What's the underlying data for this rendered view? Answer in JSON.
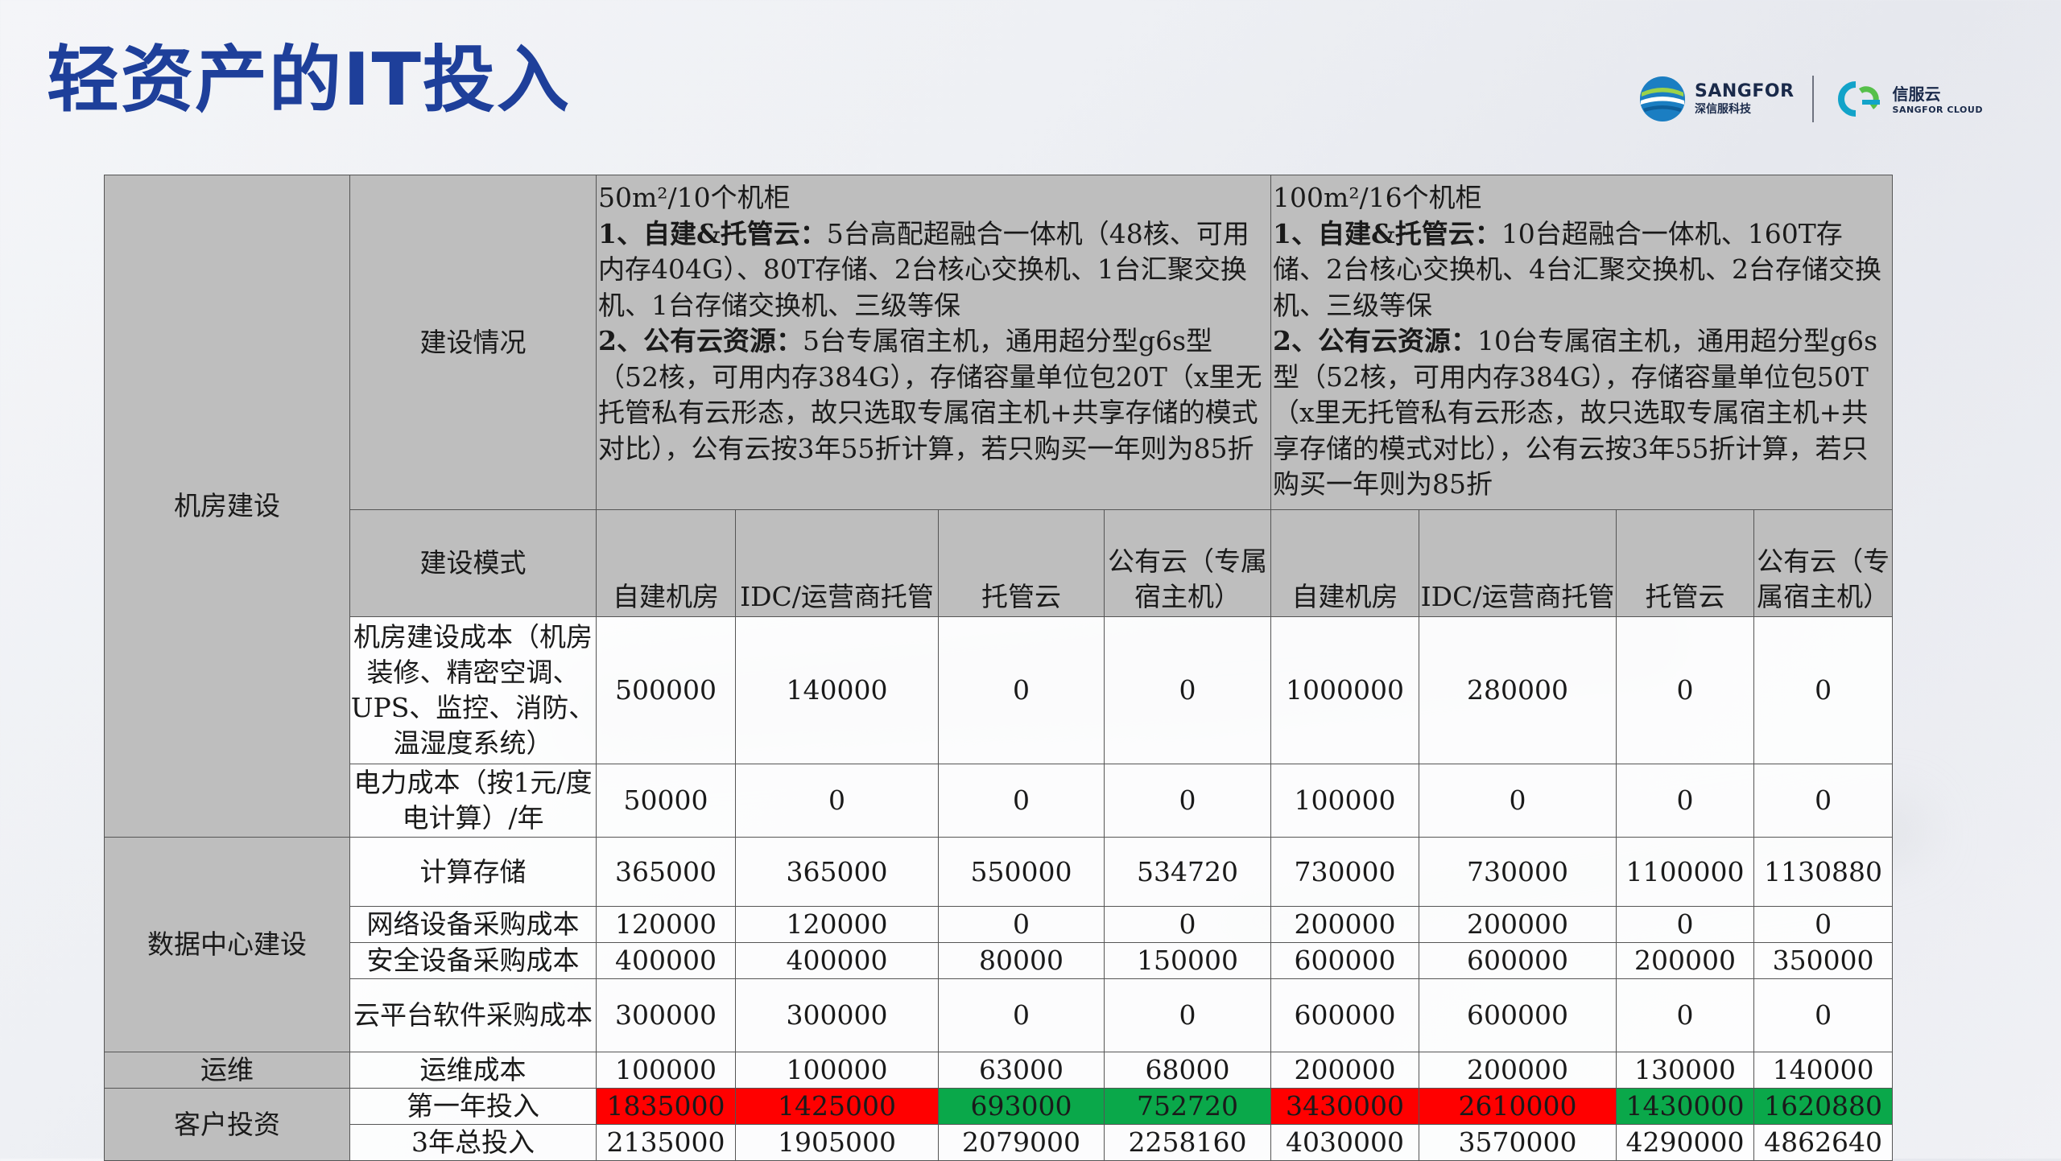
{
  "title": "轻资产的IT投入",
  "logo": {
    "en": "SANGFOR",
    "cn": "深信服科技",
    "cloud_cn": "信服云",
    "cloud_en": "SANGFOR CLOUD"
  },
  "table": {
    "groups": {
      "room": "机房建设",
      "dc": "数据中心建设",
      "ops": "运维",
      "customer": "客户投资"
    },
    "labels": {
      "situation": "建设情况",
      "mode": "建设模式",
      "room_cost": "机房建设成本（机房装修、精密空调、UPS、监控、消防、温湿度系统）",
      "power_cost": "电力成本（按1元/度电计算）/年",
      "compute": "计算存储",
      "network": "网络设备采购成本",
      "security": "安全设备采购成本",
      "cloud_sw": "云平台软件采购成本",
      "ops_cost": "运维成本",
      "first_year": "第一年投入",
      "three_year": "3年总投入"
    },
    "desc_a": {
      "heading": "50m²/10个机柜",
      "p1_bold": "1、自建&托管云：",
      "p1": "5台高配超融合一体机（48核、可用内存404G）、80T存储、2台核心交换机、1台汇聚交换机、1台存储交换机、三级等保",
      "p2_bold": "2、公有云资源：",
      "p2": "5台专属宿主机，通用超分型g6s型（52核，可用内存384G），存储容量单位包20T（x里无托管私有云形态，故只选取专属宿主机+共享存储的模式对比），公有云按3年55折计算，若只购买一年则为85折"
    },
    "desc_b": {
      "heading": "100m²/16个机柜",
      "p1_bold": "1、自建&托管云：",
      "p1": "10台超融合一体机、160T存储、2台核心交换机、4台汇聚交换机、2台存储交换机、三级等保",
      "p2_bold": "2、公有云资源：",
      "p2": "10台专属宿主机，通用超分型g6s型（52核，可用内存384G），存储容量单位包50T（x里无托管私有云形态，故只选取专属宿主机+共享存储的模式对比），公有云按3年55折计算，若只购买一年则为85折"
    },
    "modes": [
      "自建机房",
      "IDC/运营商托管",
      "托管云",
      "公有云（专属宿主机）",
      "自建机房",
      "IDC/运营商托管",
      "托管云",
      "公有云（专属宿主机）"
    ],
    "rows": {
      "room_cost": [
        "500000",
        "140000",
        "0",
        "0",
        "1000000",
        "280000",
        "0",
        "0"
      ],
      "power_cost": [
        "50000",
        "0",
        "0",
        "0",
        "100000",
        "0",
        "0",
        "0"
      ],
      "compute": [
        "365000",
        "365000",
        "550000",
        "534720",
        "730000",
        "730000",
        "1100000",
        "1130880"
      ],
      "network": [
        "120000",
        "120000",
        "0",
        "0",
        "200000",
        "200000",
        "0",
        "0"
      ],
      "security": [
        "400000",
        "400000",
        "80000",
        "150000",
        "600000",
        "600000",
        "200000",
        "350000"
      ],
      "cloud_sw": [
        "300000",
        "300000",
        "0",
        "0",
        "600000",
        "600000",
        "0",
        "0"
      ],
      "ops_cost": [
        "100000",
        "100000",
        "63000",
        "68000",
        "200000",
        "200000",
        "130000",
        "140000"
      ],
      "first_year": [
        "1835000",
        "1425000",
        "693000",
        "752720",
        "3430000",
        "2610000",
        "1430000",
        "1620880"
      ],
      "three_year": [
        "2135000",
        "1905000",
        "2079000",
        "2258160",
        "4030000",
        "3570000",
        "4290000",
        "4862640"
      ]
    },
    "first_year_colors": [
      "#ff0000",
      "#ff0000",
      "#0aa84a",
      "#0aa84a",
      "#ff0000",
      "#ff0000",
      "#0aa84a",
      "#0aa84a"
    ]
  }
}
